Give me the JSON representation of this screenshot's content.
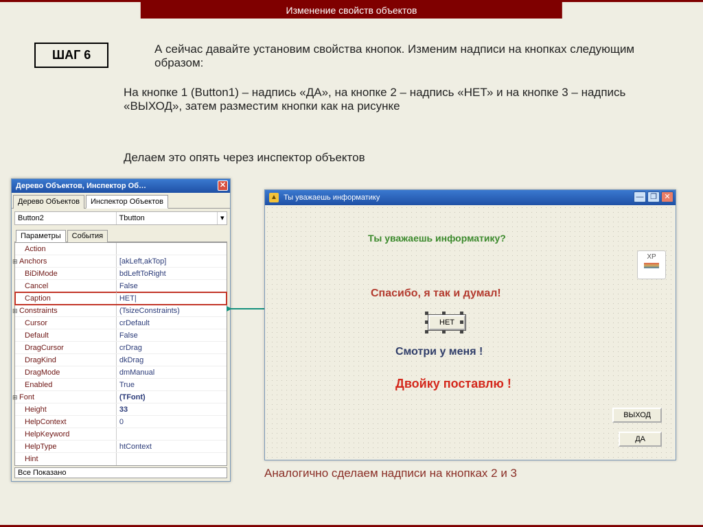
{
  "header": {
    "title": "Изменение свойств объектов"
  },
  "step": {
    "label": "ШАГ 6"
  },
  "text": {
    "p1": "А сейчас давайте установим свойства кнопок.  Изменим надписи на кнопках следующим образом:",
    "p2": "На кнопке 1 (Button1) – надпись «ДА», на кнопке 2 – надпись «НЕТ» и на кнопке 3 – надпись «ВЫХОД», затем разместим кнопки как на рисунке",
    "p3": "Делаем это опять через инспектор объектов",
    "p4": "Аналогично сделаем надписи на кнопках 2 и 3"
  },
  "inspector": {
    "title": "Дерево Объектов, Инспектор Об…",
    "tabs": {
      "tree": "Дерево Объектов",
      "inspector": "Инспектор Объектов"
    },
    "object_name": "Button2",
    "object_class": "Tbutton",
    "param_tabs": {
      "params": "Параметры",
      "events": "События"
    },
    "footer": "Все Показано",
    "props": [
      {
        "name": "Action",
        "value": "",
        "indent": true
      },
      {
        "name": "Anchors",
        "value": "[akLeft,akTop]",
        "exp": true
      },
      {
        "name": "BiDiMode",
        "value": "bdLeftToRight",
        "indent": true
      },
      {
        "name": "Cancel",
        "value": "False",
        "indent": true
      },
      {
        "name": "Caption",
        "value": "НЕТ|",
        "indent": true,
        "hl": true
      },
      {
        "name": "Constraints",
        "value": "(TsizeConstraints)",
        "exp": true
      },
      {
        "name": "Cursor",
        "value": "crDefault",
        "indent": true
      },
      {
        "name": "Default",
        "value": "False",
        "indent": true
      },
      {
        "name": "DragCursor",
        "value": "crDrag",
        "indent": true
      },
      {
        "name": "DragKind",
        "value": "dkDrag",
        "indent": true
      },
      {
        "name": "DragMode",
        "value": "dmManual",
        "indent": true
      },
      {
        "name": "Enabled",
        "value": "True",
        "indent": true
      },
      {
        "name": "Font",
        "value": "(TFont)",
        "exp": true,
        "bold": true
      },
      {
        "name": "Height",
        "value": "33",
        "indent": true,
        "bold": true
      },
      {
        "name": "HelpContext",
        "value": "0",
        "indent": true
      },
      {
        "name": "HelpKeyword",
        "value": "",
        "indent": true
      },
      {
        "name": "HelpType",
        "value": "htContext",
        "indent": true
      },
      {
        "name": "Hint",
        "value": "",
        "indent": true
      }
    ]
  },
  "form": {
    "title": "Ты уважаешь информатику",
    "xp": "XP",
    "labels": {
      "q": "Ты уважаешь информатику?",
      "ans": "Спасибо, я так и думал!",
      "warn": "Смотри у меня !",
      "threat": "Двойку поставлю !"
    },
    "buttons": {
      "net": "НЕТ",
      "exit": "ВЫХОД",
      "yes": "ДА"
    },
    "sys": {
      "min": "—",
      "max": "❐",
      "close": "✕"
    }
  }
}
